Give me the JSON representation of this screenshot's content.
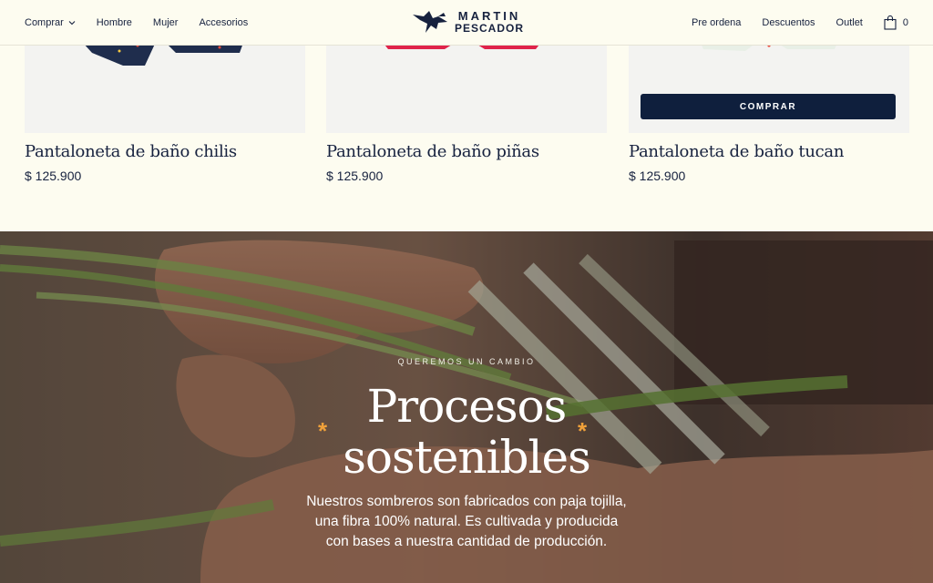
{
  "header": {
    "nav_left": [
      "Comprar",
      "Hombre",
      "Mujer",
      "Accesorios"
    ],
    "logo": {
      "line1": "MARTIN",
      "line2": "PESCADOR"
    },
    "nav_right": [
      "Pre ordena",
      "Descuentos",
      "Outlet"
    ],
    "cart_count": "0"
  },
  "products": [
    {
      "title": "Pantaloneta de baño chilis",
      "price": "$ 125.900",
      "color": "#1f2d4d",
      "dots": "#e94b3c"
    },
    {
      "title": "Pantaloneta de baño piñas",
      "price": "$ 125.900",
      "color": "#e0234a",
      "dots": "#f5c842"
    },
    {
      "title": "Pantaloneta de baño tucan",
      "price": "$ 125.900",
      "color": "#e8efe6",
      "dots": "#2f6b45"
    }
  ],
  "buy_button": "COMPRAR",
  "hero": {
    "eyebrow": "QUEREMOS UN CAMBIO",
    "title_line1": "Procesos",
    "title_line2": "sostenibles",
    "body_line1": "Nuestros sombreros son fabricados con paja tojilla,",
    "body_line2": "una fibra 100% natural. Es cultivada y producida",
    "body_line3": "con bases a nuestra cantidad de producción.",
    "accent": "#f0a13a"
  }
}
